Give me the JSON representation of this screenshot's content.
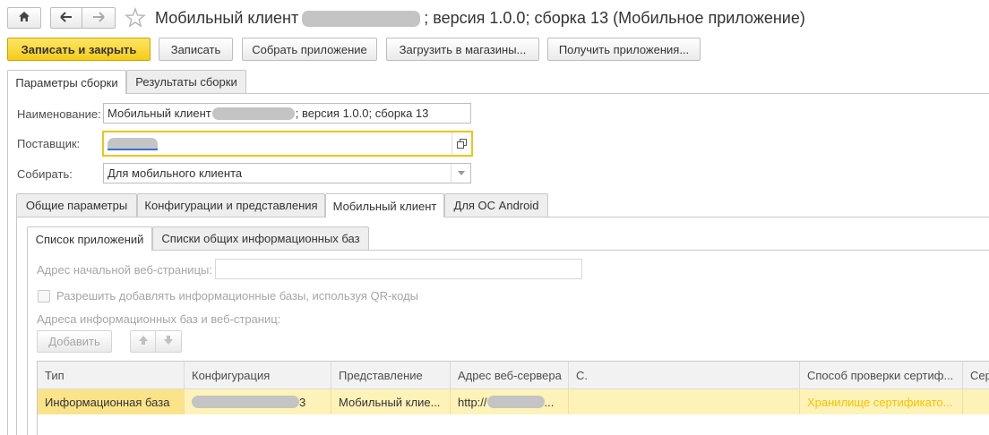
{
  "header": {
    "title_prefix": "Мобильный клиент",
    "title_suffix": "; версия 1.0.0; сборка 13 (Мобильное приложение)",
    "home_icon": "home-icon",
    "back_icon": "arrow-left-icon",
    "forward_icon": "arrow-right-icon",
    "favorite_icon": "star-icon"
  },
  "toolbar": {
    "save_close": "Записать и закрыть",
    "save": "Записать",
    "build": "Собрать приложение",
    "upload": "Загрузить в магазины...",
    "get": "Получить приложения..."
  },
  "main_tabs": [
    "Параметры сборки",
    "Результаты сборки"
  ],
  "form": {
    "name_label": "Наименование:",
    "name_prefix": "Мобильный клиент",
    "name_suffix": "; версия 1.0.0; сборка 13",
    "supplier_label": "Поставщик:",
    "build_label": "Собирать:",
    "build_value": "Для мобильного клиента"
  },
  "sub_tabs": [
    "Общие параметры",
    "Конфигурации и представления",
    "Мобильный клиент",
    "Для ОС Android"
  ],
  "inner_tabs": [
    "Список приложений",
    "Списки общих информационных баз"
  ],
  "panel": {
    "start_page_label": "Адрес начальной веб-страницы:",
    "start_page_value": "",
    "qr_checkbox_label": "Разрешить добавлять информационные базы, используя QR-коды",
    "qr_checked": false,
    "addresses_label": "Адреса информационных баз и веб-страниц:",
    "add_button": "Добавить"
  },
  "table": {
    "columns": [
      "Тип",
      "Конфигурация",
      "Представление",
      "Адрес веб-сервера",
      "С.",
      "Способ проверки сертиф...",
      "Сер"
    ],
    "rows": [
      {
        "type": "Информационная база",
        "config_suffix": "3",
        "view": "Мобильный клие...",
        "address_prefix": "http://",
        "address_suffix": "...",
        "c": "",
        "cert_method": "Хранилище сертификато...",
        "cert": ""
      }
    ]
  },
  "colors": {
    "primary_button": "#f5cc1a",
    "selected_row": "#fdf2b8",
    "focus_border": "#f0c419",
    "cert_text": "#f5c400"
  }
}
